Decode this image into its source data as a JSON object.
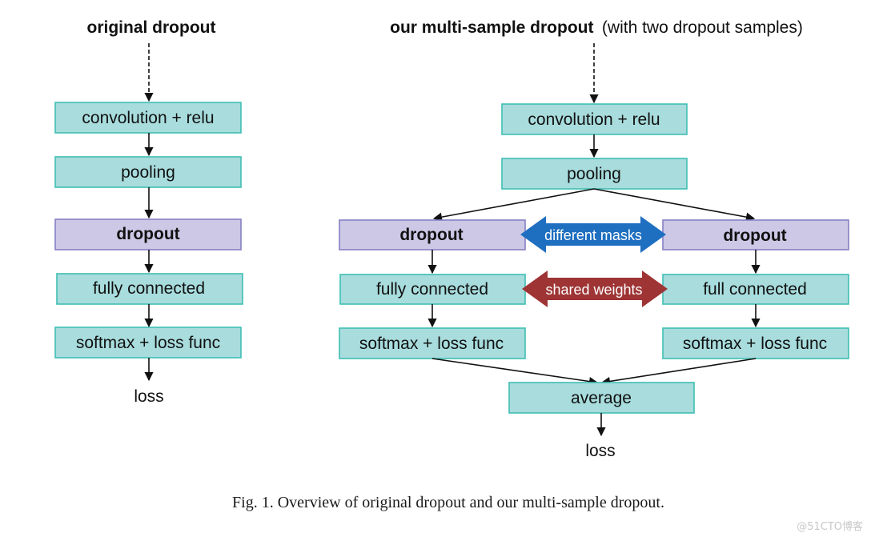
{
  "colors": {
    "layer_fill": "#a8dcdd",
    "layer_stroke": "#3fbfb3",
    "dropout_fill": "#ccc8e6",
    "dropout_stroke": "#8580c4",
    "masks_arrow": "#1f6fc0",
    "weights_arrow": "#9e3434",
    "edge": "#111111"
  },
  "left_diagram": {
    "title": "original dropout",
    "nodes": [
      {
        "id": "l-conv",
        "label": "convolution + relu",
        "type": "layer"
      },
      {
        "id": "l-pool",
        "label": "pooling",
        "type": "layer"
      },
      {
        "id": "l-drop",
        "label": "dropout",
        "type": "dropout"
      },
      {
        "id": "l-fc",
        "label": "fully connected",
        "type": "layer"
      },
      {
        "id": "l-soft",
        "label": "softmax + loss func",
        "type": "layer"
      }
    ],
    "output_label": "loss"
  },
  "right_diagram": {
    "title_bold": "our multi-sample dropout",
    "title_normal": "(with two dropout samples)",
    "shared_nodes": [
      {
        "id": "r-conv",
        "label": "convolution + relu",
        "type": "layer"
      },
      {
        "id": "r-pool",
        "label": "pooling",
        "type": "layer"
      }
    ],
    "branch_a": [
      {
        "id": "a-drop",
        "label": "dropout",
        "type": "dropout"
      },
      {
        "id": "a-fc",
        "label": "fully connected",
        "type": "layer"
      },
      {
        "id": "a-soft",
        "label": "softmax + loss func",
        "type": "layer"
      }
    ],
    "branch_b": [
      {
        "id": "b-drop",
        "label": "dropout",
        "type": "dropout"
      },
      {
        "id": "b-fc",
        "label": "full connected",
        "type": "layer"
      },
      {
        "id": "b-soft",
        "label": "softmax + loss func",
        "type": "layer"
      }
    ],
    "merge_node": {
      "id": "r-avg",
      "label": "average",
      "type": "layer"
    },
    "output_label": "loss",
    "relations": [
      {
        "label": "different masks",
        "between": [
          "a-drop",
          "b-drop"
        ],
        "color_key": "masks_arrow"
      },
      {
        "label": "shared weights",
        "between": [
          "a-fc",
          "b-fc"
        ],
        "color_key": "weights_arrow"
      }
    ]
  },
  "caption": "Fig. 1.  Overview of original dropout and our multi-sample dropout.",
  "watermark": "@51CTO博客"
}
